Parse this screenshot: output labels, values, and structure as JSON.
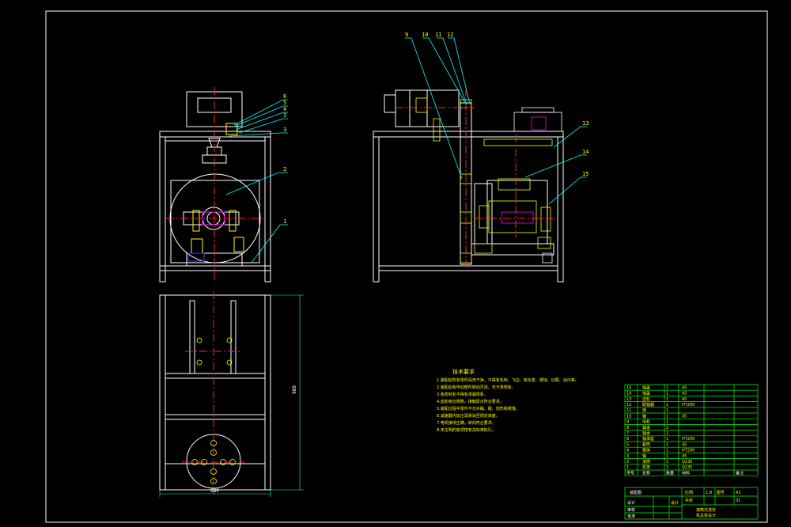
{
  "colors": {
    "background": "#000000",
    "outline": "#ffffff",
    "centerline": "#ff2020",
    "section_fill": "#ffff00",
    "leader": "#00ffff",
    "table_grid": "#00ff00",
    "hatch": "#ff00ff",
    "accent_blue": "#4040ff"
  },
  "front_view": {
    "callouts": [
      "6",
      "5",
      "4",
      "3",
      "2",
      "1"
    ]
  },
  "side_view": {
    "callouts_top": [
      "9",
      "10",
      "11",
      "12"
    ],
    "callouts_right": [
      "13",
      "14",
      "15"
    ]
  },
  "plan_view": {
    "dim_vertical": "980",
    "dim_horizontal": "680"
  },
  "tech_notes": {
    "title": "技术要求",
    "lines": [
      "1.装配前所有零件清洗干净，不得有毛刺、飞边、氧化皮、锈蚀、切屑、油污等。",
      "2.装配后各传动部件转动灵活，无卡滞现象。",
      "3.各密封处不得有渗漏现象。",
      "4.齿轮啮合侧隙，接触斑点符合要求。",
      "5.装配过程中零件不允许磕、碰、划伤和锈蚀。",
      "6.减速器内加注润滑油至规定高度。",
      "7.电机接线正确，转向符合要求。",
      "8.未注明的各项按有关标准执行。"
    ]
  },
  "parts_table": {
    "rows": [
      [
        "15",
        "端盖",
        "1",
        "45",
        ""
      ],
      [
        "14",
        "端盖",
        "1",
        "45",
        ""
      ],
      [
        "13",
        "齿轮",
        "1",
        "45",
        ""
      ],
      [
        "12",
        "联轴器",
        "1",
        "HT200",
        ""
      ],
      [
        "11",
        "链",
        "1",
        "",
        ""
      ],
      [
        "10",
        "轴",
        "1",
        "45",
        ""
      ],
      [
        "9",
        "电机",
        "1",
        "",
        ""
      ],
      [
        "8",
        "轴承",
        "2",
        "",
        ""
      ],
      [
        "7",
        "轴承",
        "2",
        "",
        ""
      ],
      [
        "6",
        "轴承座",
        "1",
        "HT200",
        ""
      ],
      [
        "5",
        "套筒",
        "1",
        "45",
        ""
      ],
      [
        "4",
        "箱体",
        "1",
        "HT200",
        ""
      ],
      [
        "3",
        "轴",
        "1",
        "45",
        ""
      ],
      [
        "2",
        "滚筒",
        "1",
        "Q235",
        ""
      ],
      [
        "1",
        "机架",
        "1",
        "Q235",
        ""
      ]
    ],
    "header": [
      "序号",
      "名称",
      "数量",
      "材料",
      "备注"
    ]
  },
  "title_block": {
    "drawing_label": "装配图",
    "ratio_label": "比例",
    "ratio": "1:8",
    "sheet_label": "图号",
    "sheet": "A1",
    "design_label": "设计",
    "check_label": "审核",
    "approve_label": "批准",
    "school": "滚筒式洗衣",
    "school2": "机总体设计",
    "count_label": "共张",
    "count": "01"
  }
}
